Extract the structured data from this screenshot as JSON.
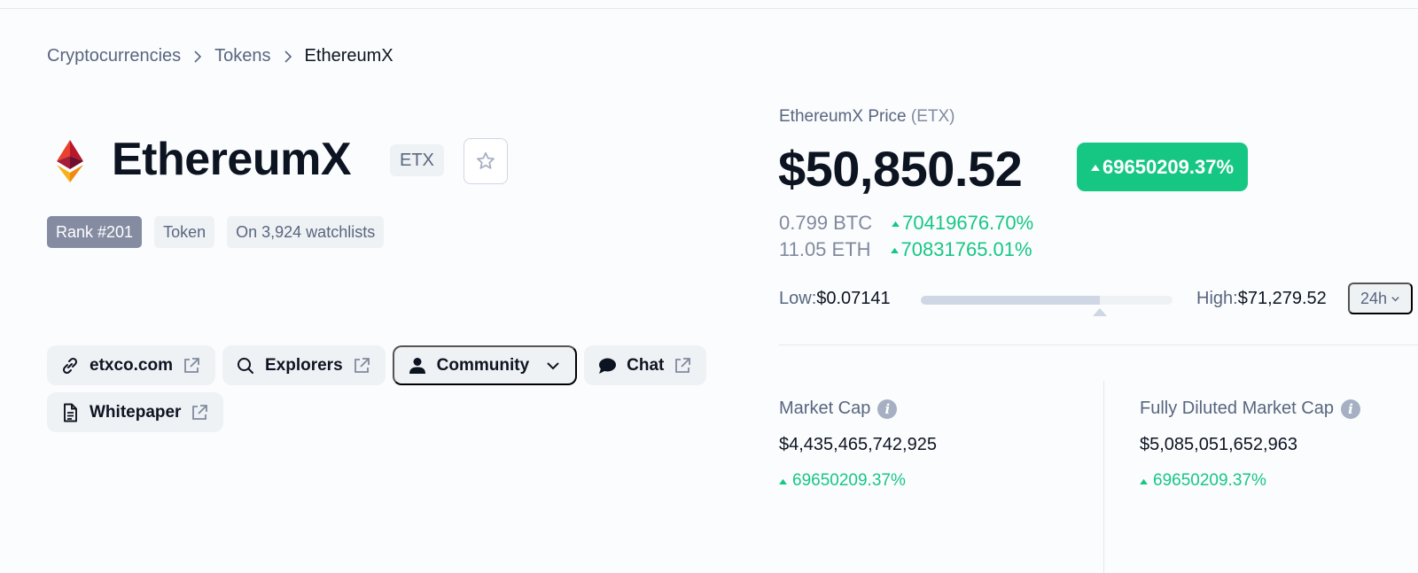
{
  "breadcrumb": {
    "items": [
      "Cryptocurrencies",
      "Tokens"
    ],
    "current": "EthereumX"
  },
  "coin": {
    "name": "EthereumX",
    "symbol": "ETX",
    "logo_icon": "ethereum-diamond-icon",
    "favorite_icon": "star-outline-icon"
  },
  "tags": {
    "rank": "Rank #201",
    "type": "Token",
    "watchlists": "On 3,924 watchlists"
  },
  "links": {
    "website": "etxco.com",
    "explorers": "Explorers",
    "community": "Community",
    "chat": "Chat",
    "whitepaper": "Whitepaper"
  },
  "price": {
    "label": "EthereumX Price",
    "label_symbol": "(ETX)",
    "value": "$50,850.52",
    "change_24h": "69650209.37%",
    "btc_value": "0.799 BTC",
    "btc_change": "70419676.70%",
    "eth_value": "11.05 ETH",
    "eth_change": "70831765.01%"
  },
  "range": {
    "low_label": "Low:",
    "low_value": "$0.07141",
    "high_label": "High:",
    "high_value": "$71,279.52",
    "position_fraction": 0.71,
    "period": "24h"
  },
  "stats": {
    "market_cap": {
      "label": "Market Cap",
      "value": "$4,435,465,742,925",
      "change": "69650209.37%"
    },
    "fully_diluted": {
      "label": "Fully Diluted Market Cap",
      "value": "$5,085,051,652,963",
      "change": "69650209.37%"
    }
  },
  "colors": {
    "positive": "#16c784",
    "text_primary": "#0d1421",
    "text_secondary": "#58667e",
    "chip_bg": "#eff2f5"
  }
}
